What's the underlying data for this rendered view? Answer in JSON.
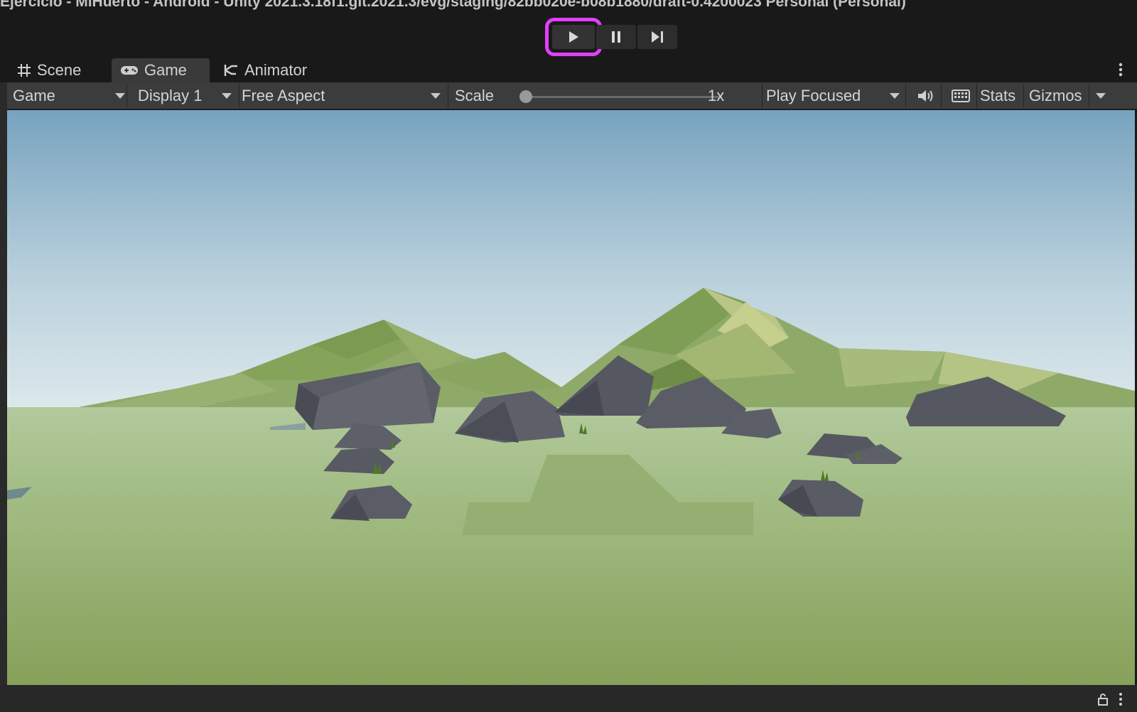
{
  "window": {
    "title": "Ejercicio - MiHuerto - Android - Unity 2021.3.18f1.git.2021.3/evg/staging/82bb020e-b08b1880/draft-0.4200023 Personal (Personal)"
  },
  "playmode": {
    "play_icon": "play-icon",
    "pause_icon": "pause-icon",
    "step_icon": "step-icon",
    "highlight_color": "#e040fb"
  },
  "tabs": [
    {
      "label": "Scene",
      "icon": "grid-icon",
      "active": false
    },
    {
      "label": "Game",
      "icon": "gamepad-icon",
      "active": true
    },
    {
      "label": "Animator",
      "icon": "animator-icon",
      "active": false
    }
  ],
  "toolbar": {
    "view_dropdown": "Game",
    "display_dropdown": "Display 1",
    "aspect_dropdown": "Free Aspect",
    "scale_label": "Scale",
    "scale_value": "1x",
    "scale_fraction": 0.0,
    "play_mode_dropdown": "Play Focused",
    "stats_label": "Stats",
    "gizmos_label": "Gizmos"
  },
  "colors": {
    "sky_top": "#7aa6c2",
    "sky_horizon": "#d4e4ea",
    "ground": "#9bb27a",
    "rock": "#5a5d66"
  }
}
